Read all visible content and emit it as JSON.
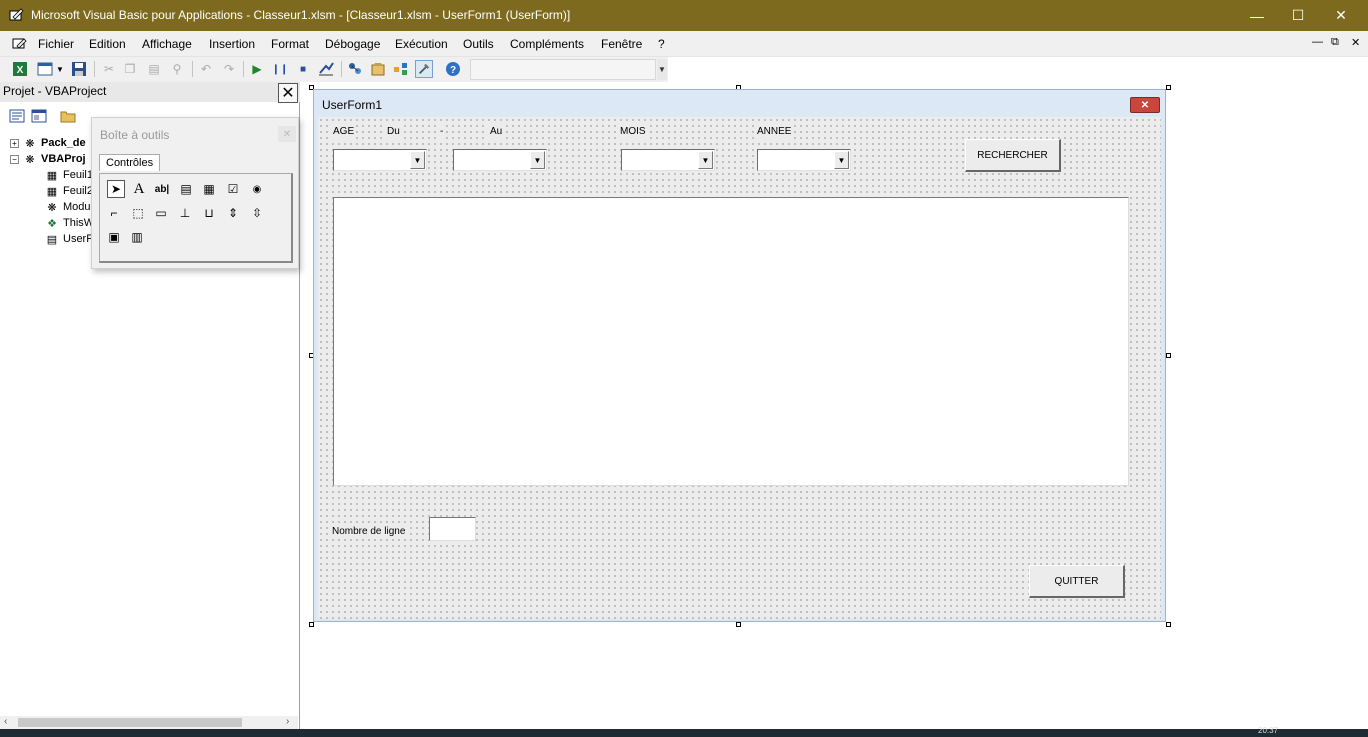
{
  "window": {
    "title": "Microsoft Visual Basic pour Applications - Classeur1.xlsm - [Classeur1.xlsm - UserForm1 (UserForm)]",
    "minimize_icon": "minimize-icon",
    "maximize_icon": "maximize-icon",
    "close_icon": "close-icon"
  },
  "menu": {
    "items": [
      "Fichier",
      "Edition",
      "Affichage",
      "Insertion",
      "Format",
      "Débogage",
      "Exécution",
      "Outils",
      "Compléments",
      "Fenêtre",
      "?"
    ]
  },
  "toolbar": {
    "icons": [
      "excel-icon",
      "insert-userform-icon",
      "save-icon",
      "cut-icon",
      "copy-icon",
      "paste-icon",
      "find-icon",
      "undo-icon",
      "redo-icon",
      "run-icon",
      "break-icon",
      "reset-icon",
      "design-mode-icon",
      "project-explorer-icon",
      "properties-icon",
      "object-browser-icon",
      "toolbox-icon",
      "help-icon"
    ]
  },
  "project_panel": {
    "title": "Projet - VBAProject",
    "tree": [
      {
        "label": "Pack_de",
        "bold": true,
        "expander": "+"
      },
      {
        "label": "VBAProj",
        "bold": true,
        "expander": "−"
      },
      {
        "label": "Feuil1",
        "bold": false
      },
      {
        "label": "Feuil2",
        "bold": false
      },
      {
        "label": "Modu",
        "bold": false
      },
      {
        "label": "ThisW",
        "bold": false
      },
      {
        "label": "UserF",
        "bold": false
      }
    ]
  },
  "toolbox": {
    "title": "Boîte à outils",
    "tab": "Contrôles",
    "tools": [
      "pointer-tool",
      "label-tool",
      "textbox-tool",
      "combobox-tool",
      "listbox-tool",
      "checkbox-tool",
      "optionbutton-tool",
      "togglebutton-tool",
      "frame-tool",
      "commandbutton-tool",
      "tabstrip-tool",
      "multipage-tool",
      "scrollbar-tool",
      "spinbutton-tool",
      "image-tool",
      "refedit-tool"
    ],
    "tool_glyphs": [
      "➤",
      "A",
      "ab|",
      "▤",
      "▦",
      "☑",
      "◉",
      "⌐",
      "⬚",
      "▭",
      "⊥",
      "⊔",
      "⇕",
      "⇳",
      "▣",
      "▥"
    ]
  },
  "userform": {
    "title": "UserForm1",
    "labels": {
      "age": "AGE",
      "du": "Du",
      "dash": "-",
      "au": "Au",
      "mois": "MOIS",
      "annee": "ANNEE",
      "nombre_de_ligne": "Nombre de ligne"
    },
    "buttons": {
      "rechercher": "RECHERCHER",
      "quitter": "QUITTER"
    }
  },
  "taskbar": {
    "clock": "20:37"
  }
}
